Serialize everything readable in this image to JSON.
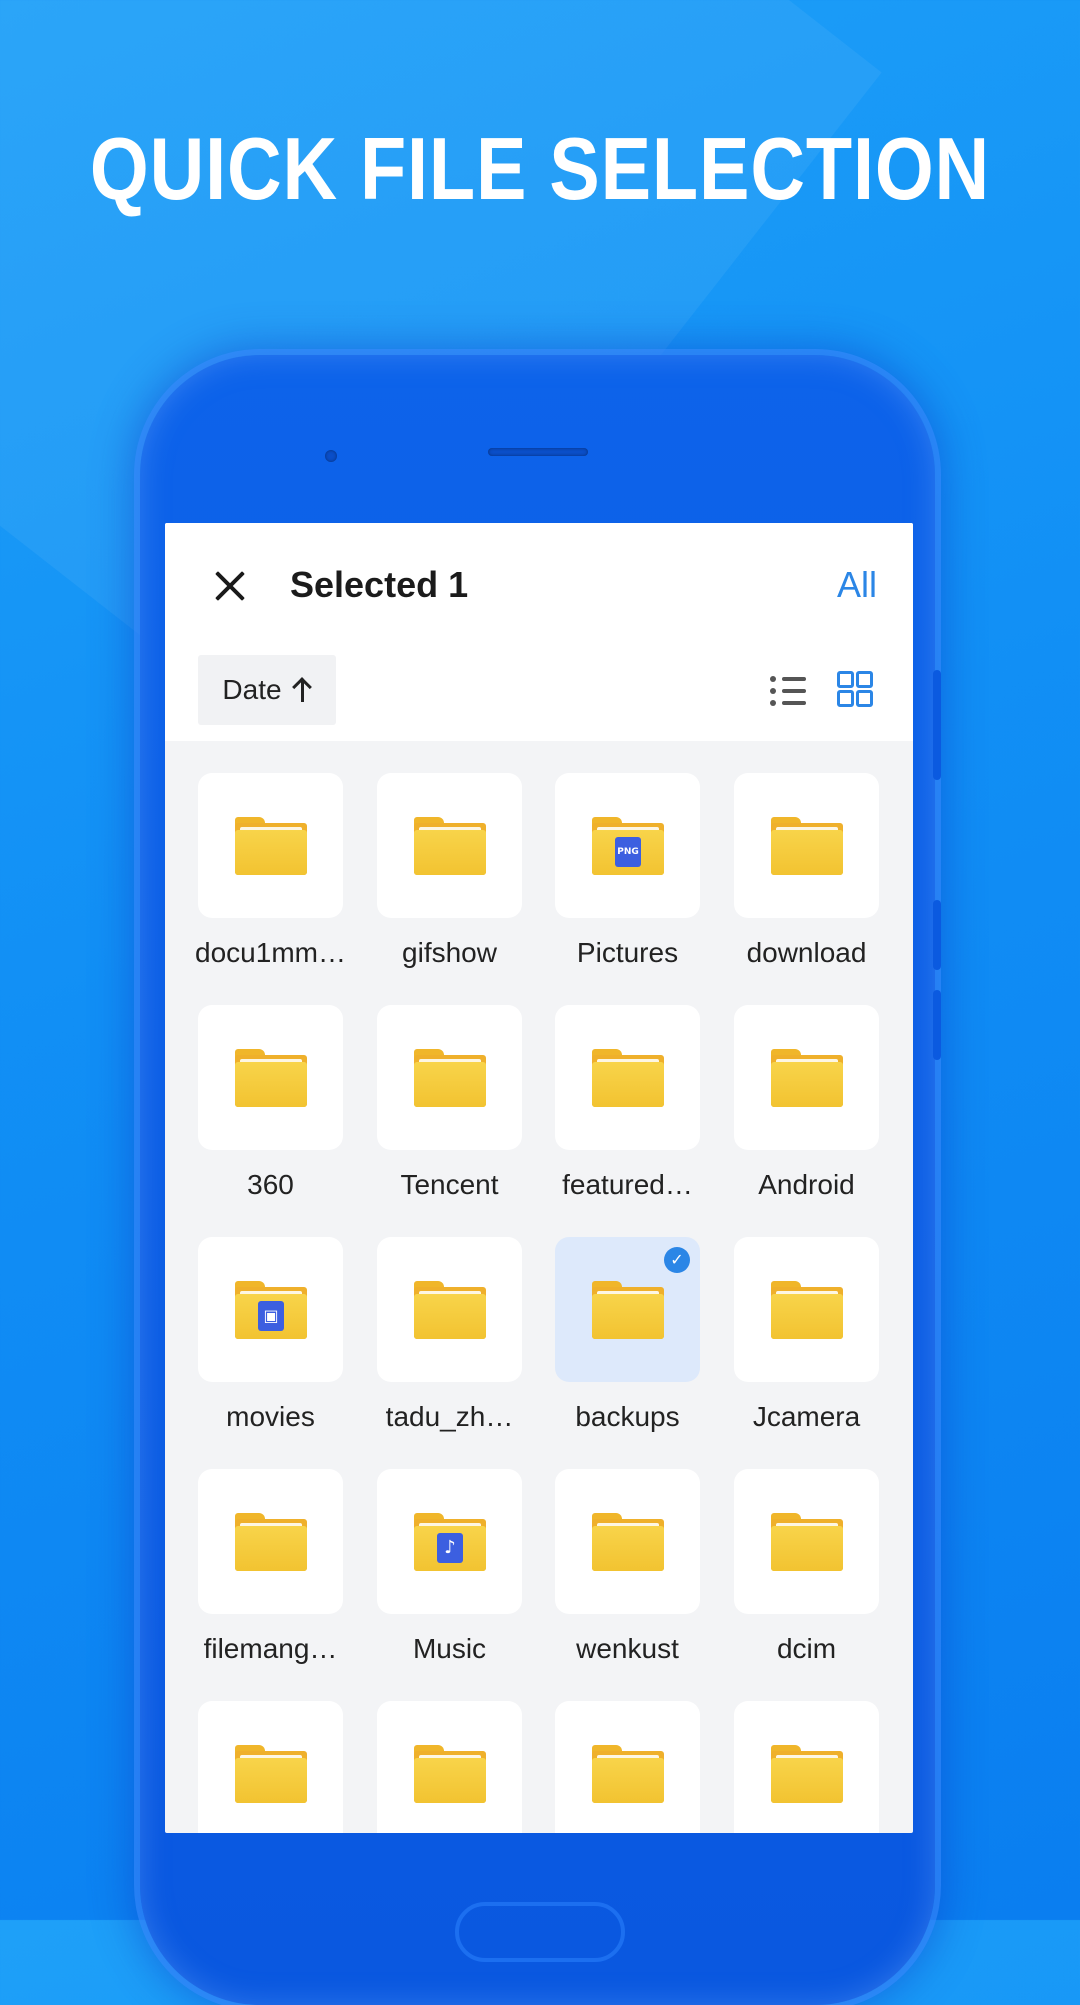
{
  "headline": "QUICK FILE SELECTION",
  "header": {
    "title": "Selected 1",
    "select_all_label": "All"
  },
  "toolbar": {
    "sort_label": "Date",
    "sort_direction_icon": "arrow-up-icon",
    "view_modes": [
      "list-view-icon",
      "grid-view-icon"
    ],
    "active_view": "grid"
  },
  "colors": {
    "accent": "#2b86e6",
    "background": "#118ff5",
    "folder": "#f2c331",
    "selected_tile": "#dde9fb"
  },
  "folders": [
    {
      "label": "docu1mm…",
      "badge": "",
      "selected": false
    },
    {
      "label": "gifshow",
      "badge": "",
      "selected": false
    },
    {
      "label": "Pictures",
      "badge": "PNG",
      "selected": false
    },
    {
      "label": "download",
      "badge": "",
      "selected": false
    },
    {
      "label": "360",
      "badge": "",
      "selected": false
    },
    {
      "label": "Tencent",
      "badge": "",
      "selected": false
    },
    {
      "label": "featured…",
      "badge": "",
      "selected": false
    },
    {
      "label": "Android",
      "badge": "",
      "selected": false
    },
    {
      "label": "movies",
      "badge": "video",
      "selected": false
    },
    {
      "label": "tadu_zh…",
      "badge": "",
      "selected": false
    },
    {
      "label": "backups",
      "badge": "",
      "selected": true
    },
    {
      "label": "Jcamera",
      "badge": "",
      "selected": false
    },
    {
      "label": "filemang…",
      "badge": "",
      "selected": false
    },
    {
      "label": "Music",
      "badge": "music",
      "selected": false
    },
    {
      "label": "wenkust",
      "badge": "",
      "selected": false
    },
    {
      "label": "dcim",
      "badge": "",
      "selected": false
    },
    {
      "label": "",
      "badge": "",
      "selected": false
    },
    {
      "label": "",
      "badge": "",
      "selected": false
    },
    {
      "label": "",
      "badge": "",
      "selected": false
    },
    {
      "label": "",
      "badge": "",
      "selected": false
    }
  ]
}
